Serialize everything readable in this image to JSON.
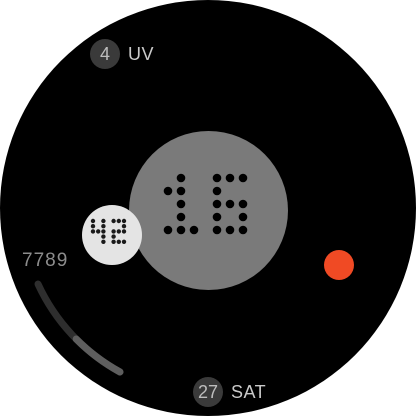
{
  "uv": {
    "value": "4",
    "label": "UV"
  },
  "time": {
    "hour": "16",
    "minute": "42"
  },
  "steps": {
    "count": "7789",
    "progress": 0.45
  },
  "date": {
    "day": "27",
    "weekday": "SAT"
  },
  "colors": {
    "face": "#000000",
    "hour_disc": "#7a7a7a",
    "minute_disc": "#e4e4e4",
    "accent": "#f04a24",
    "dots_dark": "#000000",
    "dots_minute": "#1a1a1a",
    "arc_track": "#2e2e2e",
    "arc_fill": "#5e5e5e"
  },
  "icons": {
    "second_indicator": "second-dot-icon"
  }
}
